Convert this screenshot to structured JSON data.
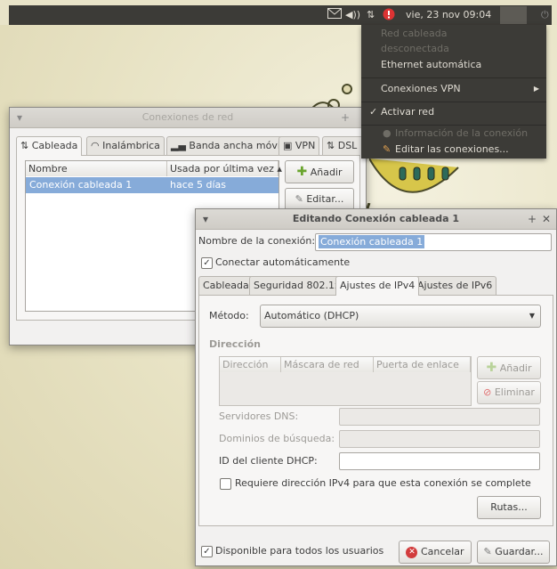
{
  "panel": {
    "clock": "vie, 23 nov 09:04"
  },
  "network_menu": {
    "items": [
      {
        "label": "Red cableada",
        "disabled": true
      },
      {
        "label": "desconectada",
        "disabled": true
      },
      {
        "label": "Ethernet automática",
        "disabled": false
      },
      {
        "label": "Conexiones VPN",
        "disabled": false
      },
      {
        "label": "Activar red",
        "disabled": false
      },
      {
        "label": "Información de la conexión",
        "disabled": true
      },
      {
        "label": "Editar las conexiones...",
        "disabled": false
      }
    ]
  },
  "connections_window": {
    "title": "Conexiones de red",
    "tabs": [
      "Cableada",
      "Inalámbrica",
      "Banda ancha móvil",
      "VPN",
      "DSL"
    ],
    "columns": [
      "Nombre",
      "Usada por última vez ▴"
    ],
    "rows": [
      {
        "name": "Conexión cableada 1",
        "last_used": "hace 5 días"
      }
    ],
    "add_button": "Añadir",
    "edit_button": "Editar..."
  },
  "edit_window": {
    "title": "Editando Conexión cableada 1",
    "name_label": "Nombre de la conexión:",
    "name_value": "Conexión cableada 1",
    "autoconnect_label": "Conectar automáticamente",
    "tabs": [
      "Cableada",
      "Seguridad 802.1x",
      "Ajustes de IPv4",
      "Ajustes de IPv6"
    ],
    "method_label": "Método:",
    "method_value": "Automático (DHCP)",
    "address_section": "Dirección",
    "address_columns": [
      "Dirección",
      "Máscara de red",
      "Puerta de enlace"
    ],
    "address_add": "Añadir",
    "address_delete": "Eliminar",
    "dns_label": "Servidores DNS:",
    "search_domains_label": "Dominios de búsqueda:",
    "dhcp_id_label": "ID del cliente DHCP:",
    "require_ipv4_label": "Requiere dirección IPv4 para que esta conexión se complete",
    "routes_button": "Rutas...",
    "all_users_label": "Disponible para todos los usuarios",
    "cancel_button": "Cancelar",
    "save_button": "Guardar..."
  }
}
